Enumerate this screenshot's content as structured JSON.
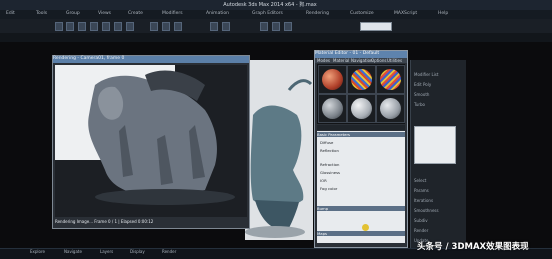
{
  "app": {
    "title": "Autodesk 3ds Max 2014 x64 - 狗.max",
    "menu": [
      "Edit",
      "Tools",
      "Group",
      "Views",
      "Create",
      "Modifiers",
      "Animation",
      "Graph Editors",
      "Rendering",
      "Customize",
      "MAXScript",
      "Help"
    ]
  },
  "render_window": {
    "title": "Rendering - Camera01, frame 0",
    "status": "Rendering Image...  Frame 0 / 1  | Elapsed 0:00:12"
  },
  "material_editor": {
    "title": "Material Editor - 01 - Default",
    "menu": [
      "Modes",
      "Material",
      "Navigation",
      "Options",
      "Utilities"
    ],
    "rows": [
      "Basic Parameters",
      "Diffuse",
      "Reflection",
      "Refraction",
      "Glossiness",
      "IOR",
      "Fog color",
      "Bump",
      "Maps"
    ]
  },
  "command_panel": {
    "rows": [
      "Modifier List",
      "Edit Poly",
      "Smooth",
      "Turbo",
      "Select",
      "Params",
      "Iterations",
      "Smoothness",
      "Subdiv",
      "Render",
      "Update"
    ]
  },
  "taskbar": {
    "items": [
      "Explore",
      "Navigate",
      "Layers",
      "Display",
      "Render"
    ]
  },
  "watermark": "头条号 / 3DMAX效果图表现"
}
